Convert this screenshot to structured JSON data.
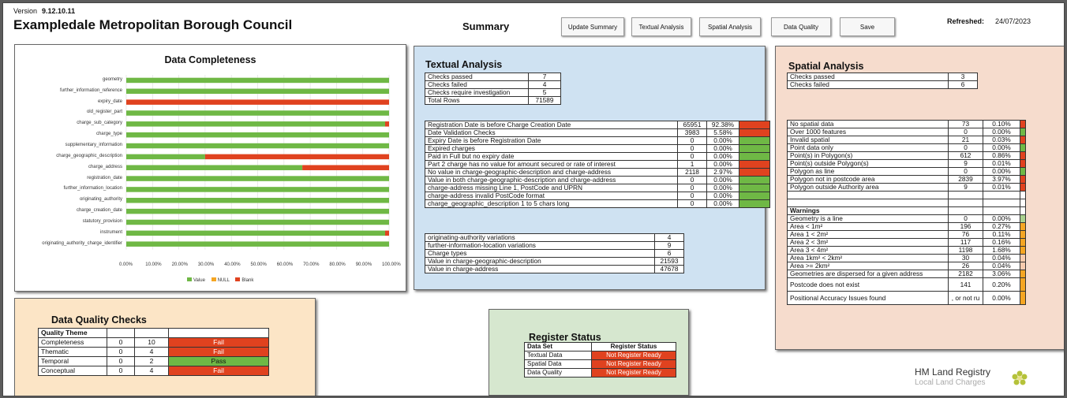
{
  "header": {
    "version_label": "Version",
    "version": "9.12.10.11",
    "council": "Exampledale Metropolitan Borough Council",
    "summary": "Summary",
    "refreshed_label": "Refreshed:",
    "refreshed": "24/07/2023"
  },
  "buttons": [
    "Update Summary",
    "Textual Analysis",
    "Spatial Analysis",
    "Data Quality",
    "Save"
  ],
  "colors": {
    "green": "#6fb845",
    "red": "#e0421f",
    "orange": "#f5a623",
    "lightgreen": "#a9d18e",
    "peach": "#f8cbad"
  },
  "completeness": {
    "title": "Data Completeness",
    "type": "bar",
    "legend": [
      "Value",
      "NULL",
      "Blank"
    ],
    "xticks": [
      "0.00%",
      "10.00%",
      "20.00%",
      "30.00%",
      "40.00%",
      "50.00%",
      "60.00%",
      "70.00%",
      "80.00%",
      "90.00%",
      "100.00%"
    ]
  },
  "chart_data": {
    "type": "bar",
    "title": "Data Completeness",
    "categories": [
      "geometry",
      "further_information_reference",
      "expiry_date",
      "old_register_part",
      "charge_sub_category",
      "charge_type",
      "supplementary_information",
      "charge_geographic_description",
      "charge_address",
      "registration_date",
      "further_information_location",
      "originating_authority",
      "charge_creation_date",
      "statutory_provision",
      "instrument",
      "originating_authority_charge_identifier"
    ],
    "series": [
      {
        "name": "Value",
        "values": [
          100,
          100,
          0,
          100,
          98.5,
          100,
          100,
          30,
          67,
          100,
          100,
          100,
          100,
          100,
          98.5,
          100
        ]
      },
      {
        "name": "NULL",
        "values": [
          0,
          0,
          0,
          0,
          0,
          0,
          0,
          0,
          0,
          0,
          0,
          0,
          0,
          0,
          0,
          0
        ]
      },
      {
        "name": "Blank",
        "values": [
          0,
          0,
          100,
          0,
          1.5,
          0,
          0,
          70,
          33,
          0,
          0,
          0,
          0,
          0,
          1.5,
          0
        ]
      }
    ],
    "xlim": [
      0,
      100
    ]
  },
  "textual": {
    "title": "Textual Analysis",
    "summary": [
      [
        "Checks passed",
        "7"
      ],
      [
        "Checks failed",
        "4"
      ],
      [
        "Checks require investigation",
        "5"
      ],
      [
        "Total Rows",
        "71589"
      ]
    ],
    "checks": [
      [
        "Registration Date is before Charge Creation Date",
        "65951",
        "92.38%",
        "red"
      ],
      [
        "Date Validation Checks",
        "3983",
        "5.58%",
        "red"
      ],
      [
        "Expiry Date is before Registration Date",
        "0",
        "0.00%",
        "green"
      ],
      [
        "Expired charges",
        "0",
        "0.00%",
        "green"
      ],
      [
        "Paid in Full but no expiry date",
        "0",
        "0.00%",
        "green"
      ],
      [
        "Part 2 charge has no value for amount secured or rate of interest",
        "1",
        "0.00%",
        "red"
      ],
      [
        "No value in charge-geographic-description and charge-address",
        "2118",
        "2.97%",
        "red"
      ],
      [
        "Value in both charge-geographic-description and charge-address",
        "0",
        "0.00%",
        "green"
      ],
      [
        "charge-address missing Line 1, PostCode and UPRN",
        "0",
        "0.00%",
        "green"
      ],
      [
        "charge-address invalid PostCode format",
        "0",
        "0.00%",
        "green"
      ],
      [
        "charge_geographic_description 1 to 5 chars long",
        "0",
        "0.00%",
        "green"
      ]
    ],
    "variations": [
      [
        "originating-authority variations",
        "4"
      ],
      [
        "further-information-location variations",
        "9"
      ],
      [
        "Charge types",
        "6"
      ],
      [
        "Value in charge-geographic-description",
        "21593"
      ],
      [
        "Value in charge-address",
        "47678"
      ]
    ]
  },
  "spatial": {
    "title": "Spatial Analysis",
    "summary": [
      [
        "Checks passed",
        "3"
      ],
      [
        "Checks failed",
        "6"
      ]
    ],
    "checks": [
      [
        "No spatial data",
        "73",
        "0.10%",
        "red"
      ],
      [
        "Over 1000 features",
        "0",
        "0.00%",
        "green"
      ],
      [
        "Invalid spatial",
        "21",
        "0.03%",
        "red"
      ],
      [
        "Point data only",
        "0",
        "0.00%",
        "green"
      ],
      [
        "Point(s) in Polygon(s)",
        "612",
        "0.86%",
        "red"
      ],
      [
        "Point(s) outside Polygon(s)",
        "9",
        "0.01%",
        "red"
      ],
      [
        "Polygon as line",
        "0",
        "0.00%",
        "green"
      ],
      [
        "Polygon not in postcode area",
        "2839",
        "3.97%",
        "red"
      ],
      [
        "Polygon outside Authority area",
        "9",
        "0.01%",
        "red"
      ]
    ],
    "warnings_label": "Warnings",
    "warnings": [
      [
        "Geometry is a line",
        "0",
        "0.00%",
        "lightgreen"
      ],
      [
        "Area < 1m²",
        "196",
        "0.27%",
        "orange"
      ],
      [
        "Area 1 < 2m²",
        "76",
        "0.11%",
        "orange"
      ],
      [
        "Area 2 < 3m²",
        "117",
        "0.16%",
        "orange"
      ],
      [
        "Area 3 < 4m²",
        "1198",
        "1.68%",
        "orange"
      ],
      [
        "Area 1km² < 2km²",
        "30",
        "0.04%",
        "peach"
      ],
      [
        "Area >= 2km²",
        "26",
        "0.04%",
        "peach"
      ],
      [
        "Geometries are dispersed for a given address",
        "2182",
        "3.06%",
        "orange"
      ],
      [
        "Postcode does not exist",
        "141",
        "0.20%",
        "orange"
      ],
      [
        "Positional Accuracy Issues found",
        ", or not ru",
        "0.00%",
        "orange"
      ]
    ]
  },
  "dqc": {
    "title": "Data Quality Checks",
    "header": "Quality Theme",
    "rows": [
      [
        "Completeness",
        "0",
        "10",
        "Fail",
        "red"
      ],
      [
        "Thematic",
        "0",
        "4",
        "Fail",
        "red"
      ],
      [
        "Temporal",
        "0",
        "2",
        "Pass",
        "green"
      ],
      [
        "Conceptual",
        "0",
        "4",
        "Fail",
        "red"
      ]
    ]
  },
  "register": {
    "title": "Register Status",
    "headers": [
      "Data Set",
      "Register Status"
    ],
    "rows": [
      [
        "Textual Data",
        "Not Register Ready"
      ],
      [
        "Spatial Data",
        "Not Register Ready"
      ],
      [
        "Data Quality",
        "Not Register Ready"
      ]
    ]
  },
  "brand": {
    "line1": "HM Land Registry",
    "line2": "Local Land Charges",
    "logo": "flower-logo-icon"
  }
}
